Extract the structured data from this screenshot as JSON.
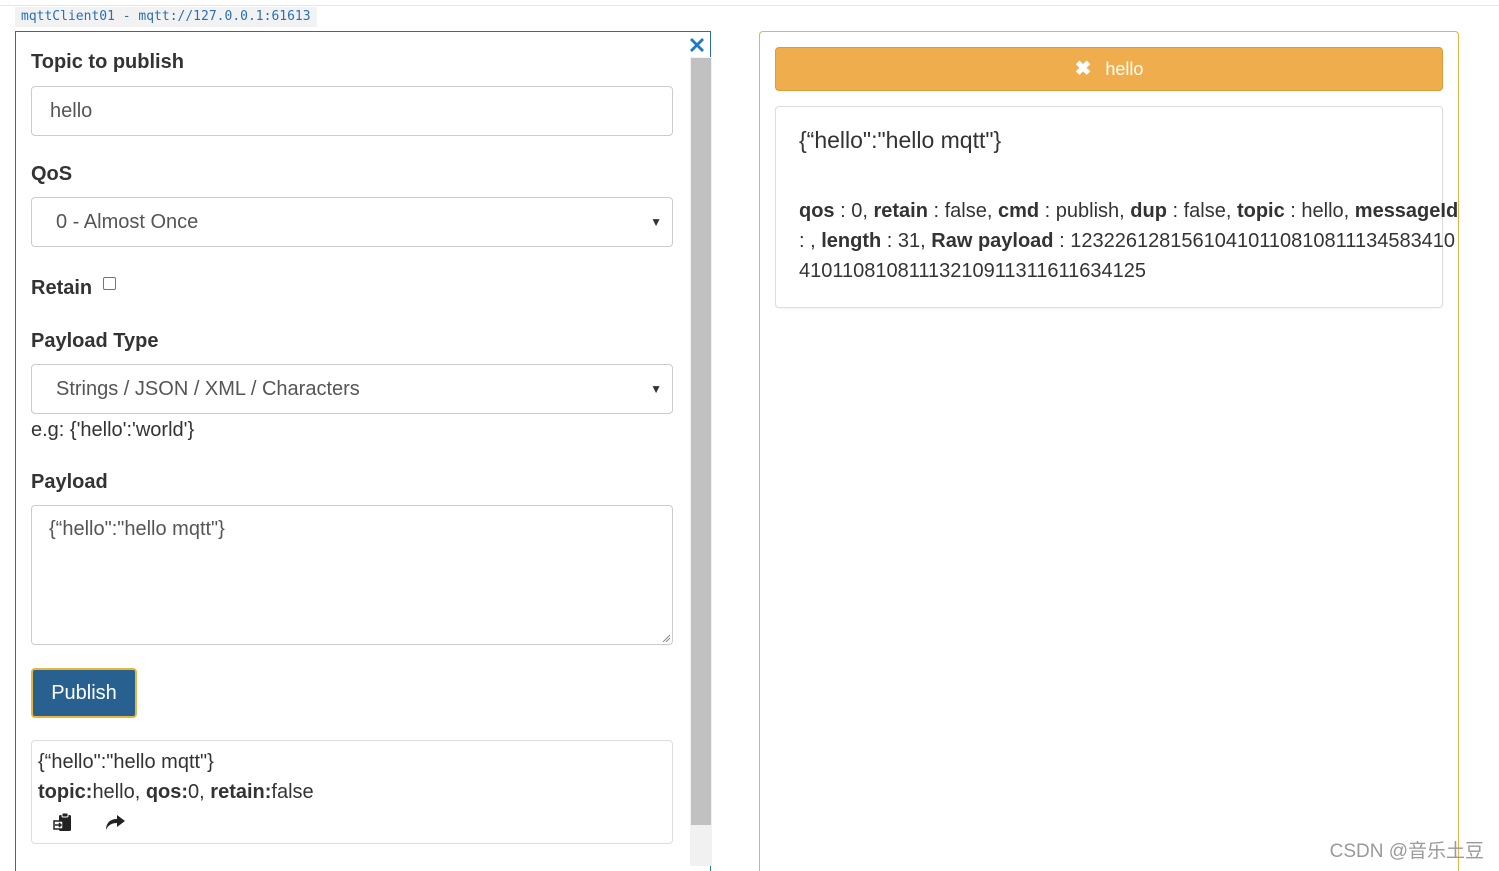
{
  "client_tab": "mqttClient01 - mqtt://127.0.0.1:61613",
  "publish_form": {
    "topic_label": "Topic to publish",
    "topic_value": "hello",
    "qos_label": "QoS",
    "qos_selected": "0 - Almost Once",
    "retain_label": "Retain",
    "retain_checked": false,
    "payload_type_label": "Payload Type",
    "payload_type_selected": "Strings / JSON / XML / Characters",
    "payload_type_hint": "e.g: {'hello':'world'}",
    "payload_label": "Payload",
    "payload_value": "{“hello\":\"hello mqtt\"}",
    "publish_button": "Publish"
  },
  "history": {
    "payload": "{“hello\":\"hello mqtt\"}",
    "topic_key": "topic:",
    "topic_val": "hello, ",
    "qos_key": "qos:",
    "qos_val": "0, ",
    "retain_key": "retain:",
    "retain_val": "false"
  },
  "subscription": {
    "topic": "hello",
    "accent_color": "#f0ad4e"
  },
  "message": {
    "payload": "{“hello\":\"hello mqtt\"}",
    "qos_key": "qos",
    "qos_val": " : 0, ",
    "retain_key": "retain",
    "retain_val": " : false, ",
    "cmd_key": "cmd",
    "cmd_val": " : publish, ",
    "dup_key": "dup",
    "dup_val": " : false, ",
    "topic_key": "topic",
    "topic_val": " : hello, ",
    "messageid_key": "messageId",
    "messageid_val": " : , ",
    "length_key": "length",
    "length_val": " : 31, ",
    "raw_key": "Raw payload",
    "raw_val": " : 1232261281561041011081081113458341041011081081113210911311611634125"
  },
  "watermark": "CSDN @音乐土豆",
  "colors": {
    "primary_button": "#286090",
    "panel_border_left": "#2a6fa8",
    "panel_border_right": "#e8b24a"
  },
  "icons": [
    "close-icon",
    "caret-down-icon",
    "paste-icon",
    "share-icon",
    "close-icon-white"
  ]
}
